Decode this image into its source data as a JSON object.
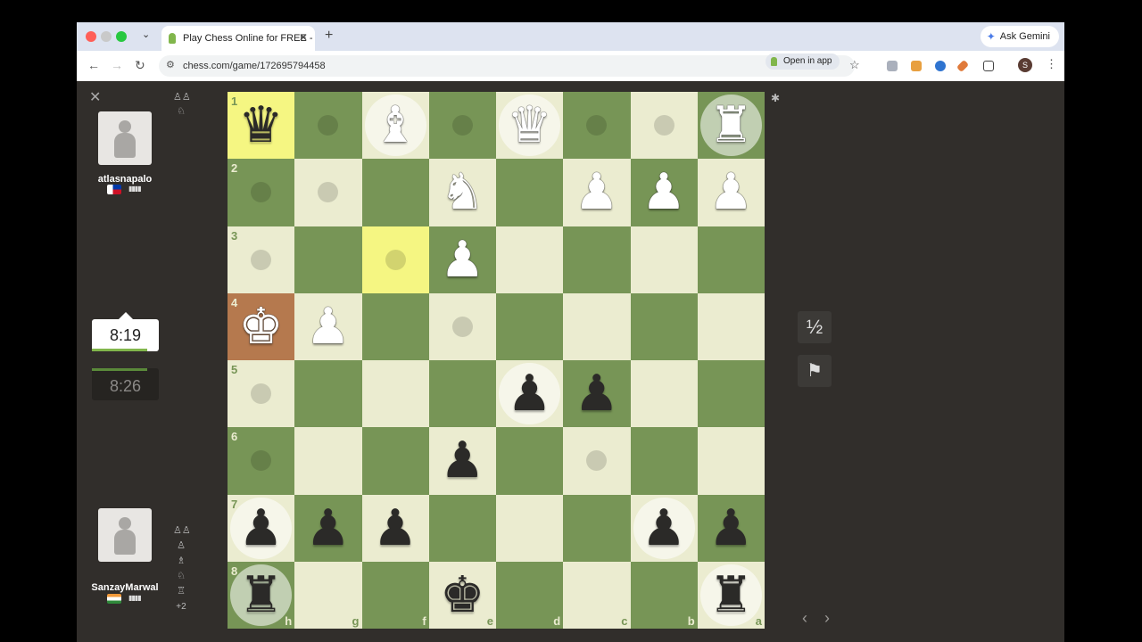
{
  "browser": {
    "tab_title": "Play Chess Online for FREE -",
    "close_tab": "✕",
    "new_tab": "+",
    "tab_menu": "⌄",
    "gemini_label": "Ask Gemini",
    "url": "chess.com/game/172695794458",
    "open_in_app": "Open in app",
    "profile_initial": "S"
  },
  "game": {
    "top_player": {
      "username": "atlasnapalo",
      "clock": "8:19"
    },
    "bottom_player": {
      "username": "SanzayMarwal",
      "clock": "8:26",
      "captured_more": "+2"
    },
    "buttons": {
      "draw": "½",
      "resign": "⚑"
    },
    "board": {
      "orientation": "black",
      "ranks": [
        "1",
        "2",
        "3",
        "4",
        "5",
        "6",
        "7",
        "8"
      ],
      "files": [
        "h",
        "g",
        "f",
        "e",
        "d",
        "c",
        "b",
        "a"
      ],
      "pieces": [
        [
          "bq",
          "",
          "wb",
          "",
          "wq",
          "",
          "",
          "wr"
        ],
        [
          "",
          "",
          "",
          "wn",
          "",
          "wp",
          "wp",
          "wp"
        ],
        [
          "",
          "",
          "",
          "wp",
          "",
          "",
          "",
          ""
        ],
        [
          "wk",
          "wp",
          "",
          "",
          "",
          "",
          "",
          ""
        ],
        [
          "",
          "",
          "",
          "",
          "bp",
          "bp",
          "",
          ""
        ],
        [
          "",
          "",
          "",
          "bp",
          "",
          "",
          "",
          ""
        ],
        [
          "bp",
          "bp",
          "bp",
          "",
          "",
          "",
          "bp",
          "bp"
        ],
        [
          "br",
          "",
          "",
          "bk",
          "",
          "",
          "",
          "br"
        ]
      ],
      "highlights": [
        "0-0",
        "2-2"
      ],
      "check": "3-0",
      "move_dots": [
        "0-1",
        "0-3",
        "0-5",
        "0-6",
        "1-0",
        "1-1",
        "2-0",
        "2-2",
        "3-3",
        "4-0",
        "5-0",
        "5-5"
      ],
      "capture_rings": [
        "0-2",
        "0-4",
        "0-7",
        "4-4",
        "6-0",
        "6-6",
        "7-0",
        "7-7"
      ]
    }
  },
  "colors": {
    "light_square": "#ebecd0",
    "dark_square": "#779556",
    "highlight": "#f5f682",
    "check": "#b5794e",
    "background": "#312e2b"
  }
}
